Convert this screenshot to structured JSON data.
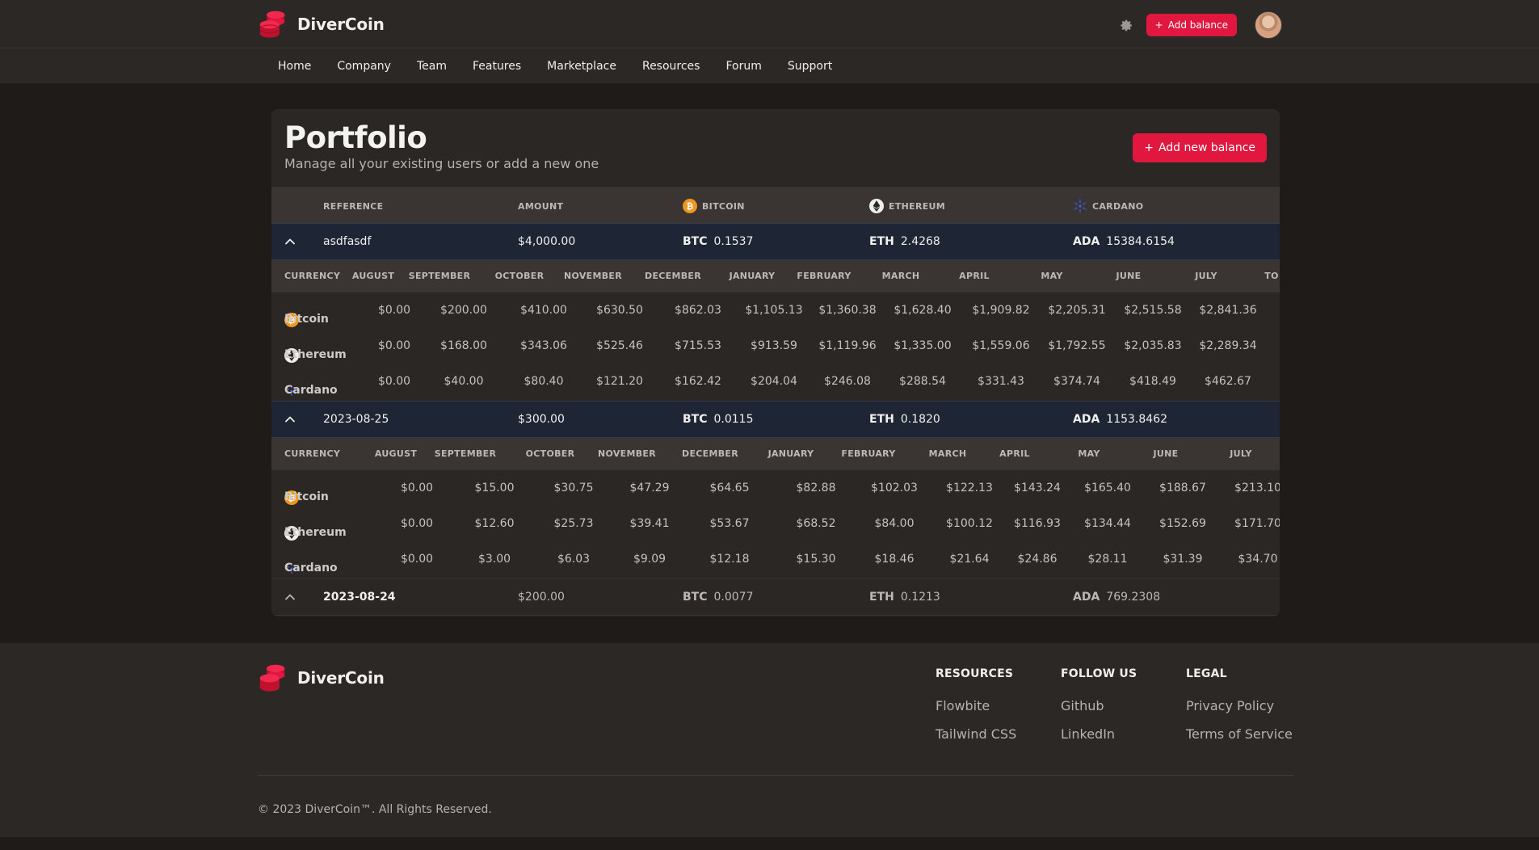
{
  "brand": {
    "name": "DiverCoin"
  },
  "header": {
    "add_balance_label": "Add balance",
    "plus": "+"
  },
  "nav": [
    "Home",
    "Company",
    "Team",
    "Features",
    "Marketplace",
    "Resources",
    "Forum",
    "Support"
  ],
  "portfolio": {
    "title": "Portfolio",
    "subtitle": "Manage all your existing users or add a new one",
    "add_new_label": "Add new balance",
    "columns": {
      "reference": "REFERENCE",
      "amount": "AMOUNT",
      "bitcoin": "BITCOIN",
      "ethereum": "ETHEREUM",
      "cardano": "CARDANO"
    },
    "symbols": {
      "btc": "BTC",
      "eth": "ETH",
      "ada": "ADA"
    },
    "month_headers": [
      "CURRENCY",
      "AUGUST",
      "SEPTEMBER",
      "OCTOBER",
      "NOVEMBER",
      "DECEMBER",
      "JANUARY",
      "FEBRUARY",
      "MARCH",
      "APRIL",
      "MAY",
      "JUNE",
      "JULY",
      "TO"
    ],
    "balances": [
      {
        "reference": "asdfasdf",
        "amount": "$4,000.00",
        "btc": "0.1537",
        "eth": "2.4268",
        "ada": "15384.6154",
        "expanded": true,
        "rows": [
          {
            "currency": "Bitcoin",
            "values": [
              "$0.00",
              "$200.00",
              "$410.00",
              "$630.50",
              "$862.03",
              "$1,105.13",
              "$1,360.38",
              "$1,628.40",
              "$1,909.82",
              "$2,205.31",
              "$2,515.58",
              "$2,841.36"
            ]
          },
          {
            "currency": "Ethereum",
            "values": [
              "$0.00",
              "$168.00",
              "$343.06",
              "$525.46",
              "$715.53",
              "$913.59",
              "$1,119.96",
              "$1,335.00",
              "$1,559.06",
              "$1,792.55",
              "$2,035.83",
              "$2,289.34"
            ]
          },
          {
            "currency": "Cardano",
            "values": [
              "$0.00",
              "$40.00",
              "$80.40",
              "$121.20",
              "$162.42",
              "$204.04",
              "$246.08",
              "$288.54",
              "$331.43",
              "$374.74",
              "$418.49",
              "$462.67"
            ]
          }
        ]
      },
      {
        "reference": "2023-08-25",
        "amount": "$300.00",
        "btc": "0.0115",
        "eth": "0.1820",
        "ada": "1153.8462",
        "expanded": true,
        "rows": [
          {
            "currency": "Bitcoin",
            "values": [
              "$0.00",
              "$15.00",
              "$30.75",
              "$47.29",
              "$64.65",
              "$82.88",
              "$102.03",
              "$122.13",
              "$143.24",
              "$165.40",
              "$188.67",
              "$213.10"
            ]
          },
          {
            "currency": "Ethereum",
            "values": [
              "$0.00",
              "$12.60",
              "$25.73",
              "$39.41",
              "$53.67",
              "$68.52",
              "$84.00",
              "$100.12",
              "$116.93",
              "$134.44",
              "$152.69",
              "$171.70"
            ]
          },
          {
            "currency": "Cardano",
            "values": [
              "$0.00",
              "$3.00",
              "$6.03",
              "$9.09",
              "$12.18",
              "$15.30",
              "$18.46",
              "$21.64",
              "$24.86",
              "$28.11",
              "$31.39",
              "$34.70"
            ]
          }
        ]
      },
      {
        "reference": "2023-08-24",
        "amount": "$200.00",
        "btc": "0.0077",
        "eth": "0.1213",
        "ada": "769.2308",
        "expanded": false
      }
    ]
  },
  "footer": {
    "resources": {
      "title": "RESOURCES",
      "links": [
        "Flowbite",
        "Tailwind CSS"
      ]
    },
    "follow": {
      "title": "FOLLOW US",
      "links": [
        "Github",
        "LinkedIn"
      ]
    },
    "legal": {
      "title": "LEGAL",
      "links": [
        "Privacy Policy",
        "Terms of Service"
      ]
    },
    "copyright": "© 2023 DiverCoin™. All Rights Reserved."
  },
  "colors": {
    "accent": "#e2173f",
    "bitcoin": "#f2951c",
    "cardano": "#3b5bd6",
    "bg": "#1e1b19",
    "surface": "#2a2725"
  }
}
